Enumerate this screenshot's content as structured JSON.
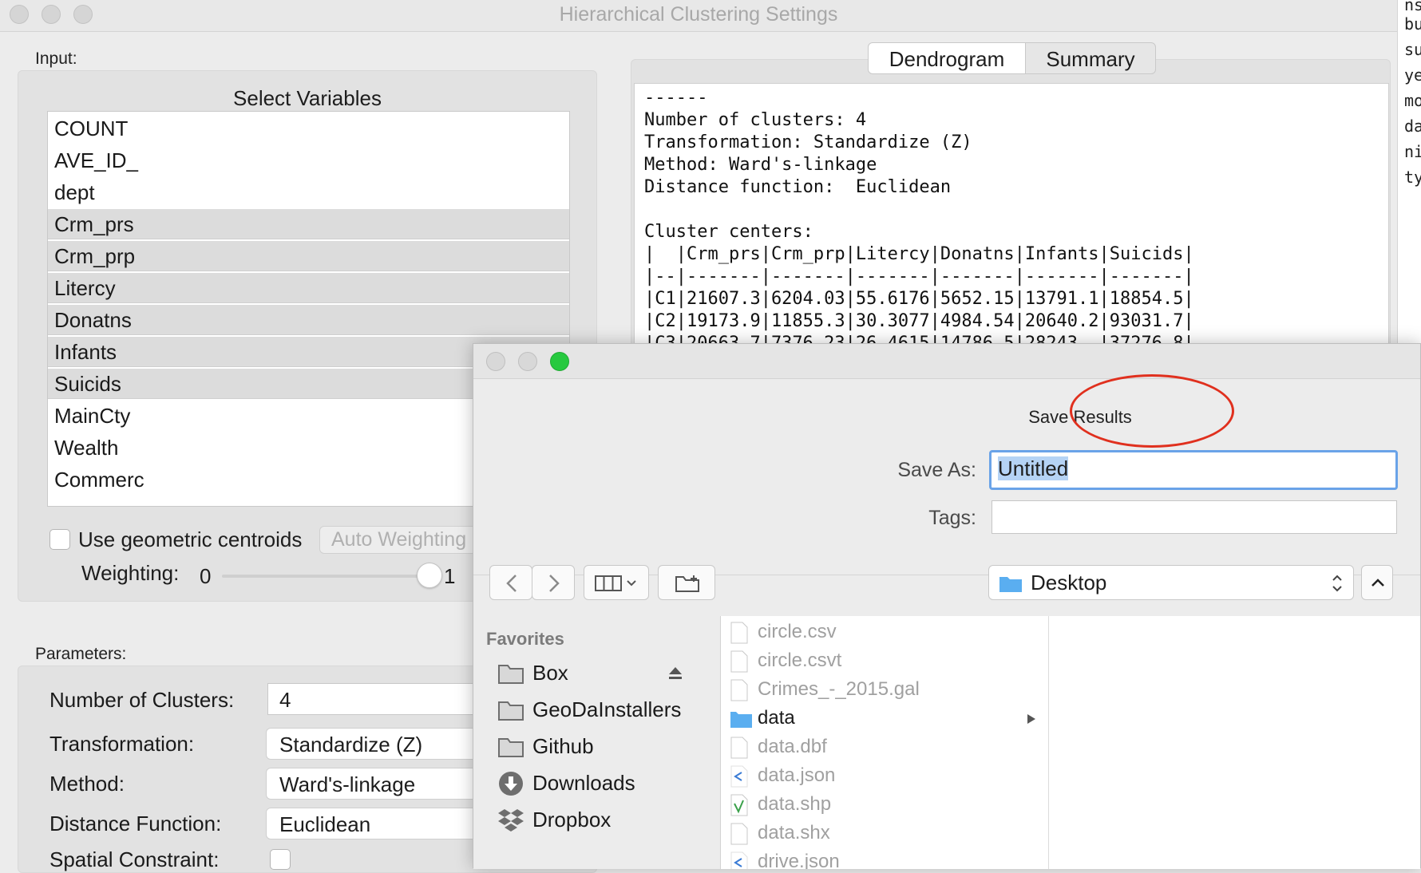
{
  "main_window": {
    "title": "Hierarchical Clustering Settings",
    "input_label": "Input:",
    "select_variables_title": "Select Variables",
    "variables": [
      {
        "name": "COUNT",
        "selected": false
      },
      {
        "name": "AVE_ID_",
        "selected": false
      },
      {
        "name": "dept",
        "selected": false
      },
      {
        "name": "Crm_prs",
        "selected": true
      },
      {
        "name": "Crm_prp",
        "selected": true
      },
      {
        "name": "Litercy",
        "selected": true
      },
      {
        "name": "Donatns",
        "selected": true
      },
      {
        "name": "Infants",
        "selected": true
      },
      {
        "name": "Suicids",
        "selected": true
      },
      {
        "name": "MainCty",
        "selected": false
      },
      {
        "name": "Wealth",
        "selected": false
      },
      {
        "name": "Commerc",
        "selected": false
      }
    ],
    "use_geometric_centroids_label": "Use geometric centroids",
    "auto_weighting_label": "Auto Weighting",
    "weighting_label": "Weighting:",
    "weighting_min": "0",
    "weighting_max": "1",
    "weighting_value": 1,
    "parameters_label": "Parameters:",
    "params": {
      "num_clusters_label": "Number of Clusters:",
      "num_clusters_value": "4",
      "transformation_label": "Transformation:",
      "transformation_value": "Standardize (Z)",
      "method_label": "Method:",
      "method_value": "Ward's-linkage",
      "distance_label": "Distance Function:",
      "distance_value": "Euclidean",
      "spatial_label": "Spatial Constraint:"
    },
    "tabs": {
      "dendrogram": "Dendrogram",
      "summary": "Summary"
    },
    "summary_text": "------\nNumber of clusters: 4\nTransformation: Standardize (Z)\nMethod: Ward's-linkage\nDistance function:  Euclidean\n\nCluster centers:\n|  |Crm_prs|Crm_prp|Litercy|Donatns|Infants|Suicids|\n|--|-------|-------|-------|-------|-------|-------|\n|C1|21607.3|6204.03|55.6176|5652.15|13791.1|18854.5|\n|C2|19173.9|11855.3|30.3077|4984.54|20640.2|93031.7|\n|C3|20663.7|7376.23|26.4615|14786.5|28243. |37276.8|"
  },
  "edge_strip_lines": [
    "ns",
    "bu",
    "su",
    "ye",
    "mo",
    "da",
    "ni",
    "ty"
  ],
  "save_dialog": {
    "title": "Save Results",
    "save_as_label": "Save As:",
    "save_as_value": "Untitled",
    "tags_label": "Tags:",
    "location": "Desktop",
    "favorites_header": "Favorites",
    "favorites": [
      {
        "label": "Box",
        "icon": "folder-icon"
      },
      {
        "label": "GeoDaInstallers",
        "icon": "folder-icon"
      },
      {
        "label": "Github",
        "icon": "folder-icon"
      },
      {
        "label": "Downloads",
        "icon": "download-icon"
      },
      {
        "label": "Dropbox",
        "icon": "dropbox-icon"
      }
    ],
    "files": [
      {
        "name": "circle.csv",
        "type": "file"
      },
      {
        "name": "circle.csvt",
        "type": "file"
      },
      {
        "name": "Crimes_-_2015.gal",
        "type": "file"
      },
      {
        "name": "data",
        "type": "folder"
      },
      {
        "name": "data.dbf",
        "type": "file"
      },
      {
        "name": "data.json",
        "type": "code"
      },
      {
        "name": "data.shp",
        "type": "shp"
      },
      {
        "name": "data.shx",
        "type": "file"
      },
      {
        "name": "drive.json",
        "type": "code"
      }
    ],
    "colors": {
      "highlight_ring": "#e0301e",
      "focus_border": "#6aa3e8",
      "folder_blue": "#5aaef0",
      "close_green": "#27c93f"
    }
  }
}
